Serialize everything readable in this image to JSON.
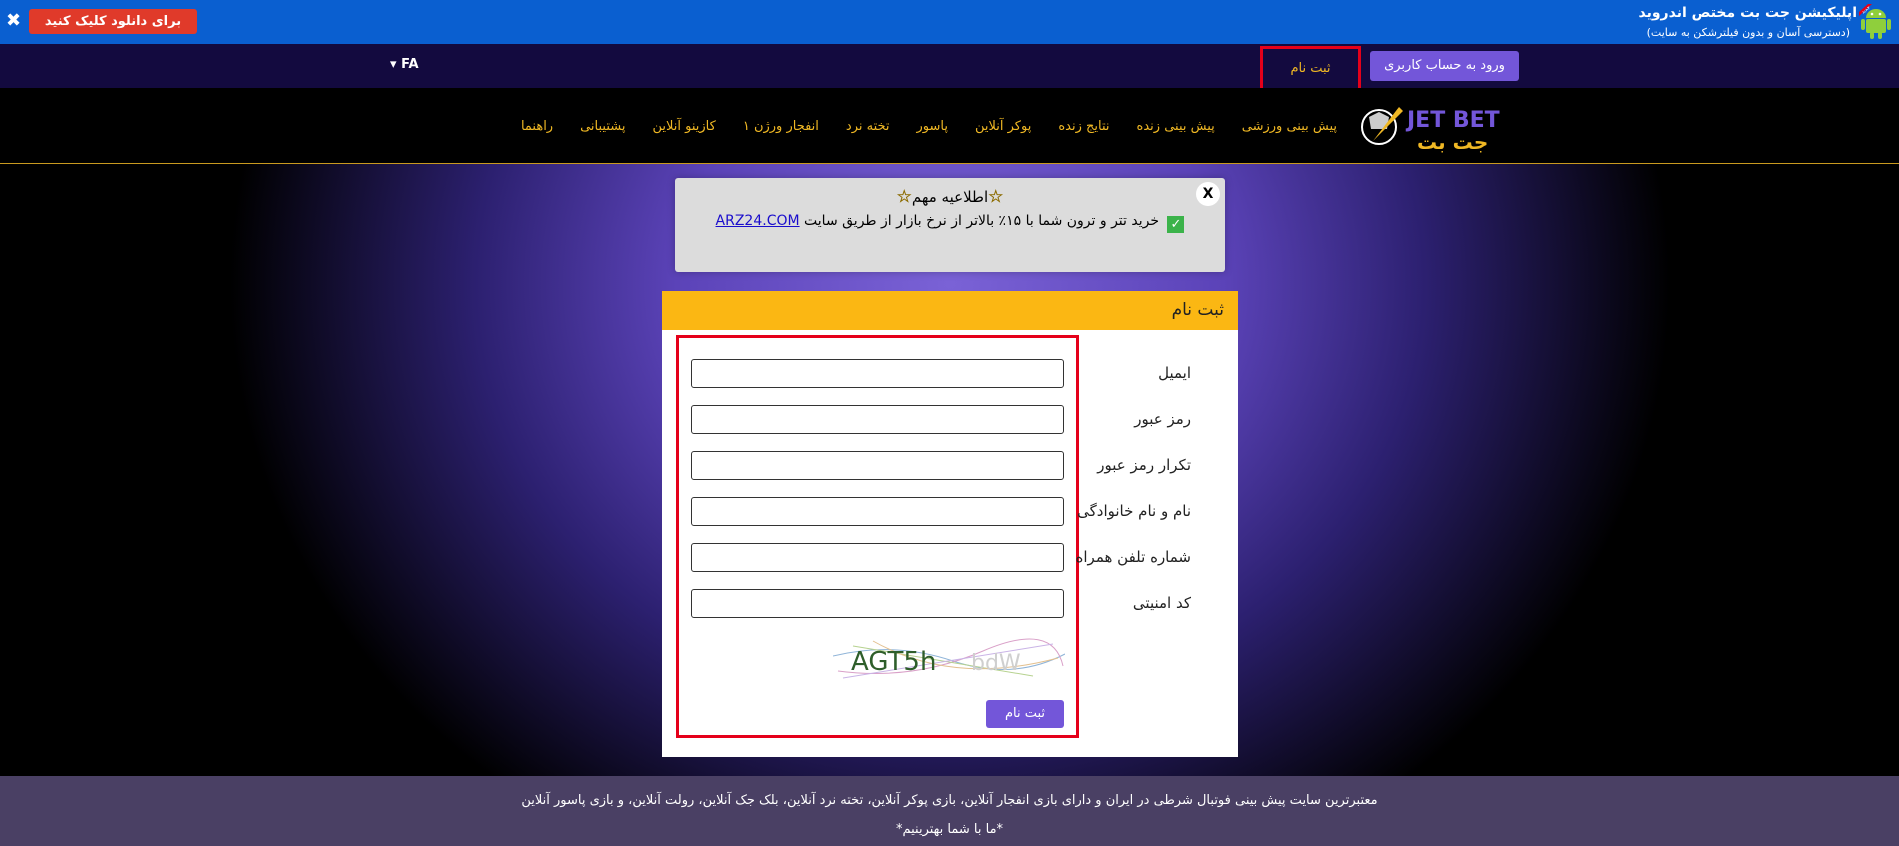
{
  "top_banner": {
    "close_icon": "close-icon",
    "download_button": "برای دانلود کلیک کنید",
    "app_title": "اپلیکیشن جت بت مختص اندروید",
    "app_subtitle": "(دسترسی آسان و بدون فیلترشکن به سایت)",
    "badge": "جدید",
    "icon": "android-icon"
  },
  "user_bar": {
    "login_button": "ورود به حساب کاربری",
    "register_link": "ثبت نام",
    "language": "FA",
    "language_icon": "caret-down-icon"
  },
  "nav": {
    "logo_top": "JET BET",
    "logo_bottom": "جت بت",
    "items": [
      "پیش بینی ورزشی",
      "پیش بینی زنده",
      "نتایج زنده",
      "پوکر آنلاین",
      "پاسور",
      "تخته نرد",
      "انفجار ورژن ۱",
      "کازینو آنلاین",
      "پشتیبانی",
      "راهنما"
    ]
  },
  "notice": {
    "close": "X",
    "title": "اطلاعیه مهم",
    "body": "خرید تتر و ترون شما با ۱۵٪ بالاتر از نرخ بازار از طریق سایت",
    "link": "ARZ24.COM",
    "icons": [
      "star-icon",
      "check-icon"
    ]
  },
  "registration": {
    "title": "ثبت نام",
    "fields": {
      "email": "ایمیل",
      "password": "رمز عبور",
      "password_repeat": "تکرار رمز عبور",
      "full_name": "نام و نام خانوادگی",
      "mobile": "شماره تلفن همراه",
      "security_code": "کد امنیتی"
    },
    "values": {
      "email": "",
      "password": "",
      "password_repeat": "",
      "full_name": "",
      "mobile": "",
      "security_code": ""
    },
    "captcha_text": "AGT5h",
    "submit": "ثبت نام"
  },
  "footer": {
    "line1": "معتبرترین سایت پیش بینی فوتبال شرطی در ایران و دارای بازی انفجار آنلاین، بازی پوکر آنلاین، تخته نرد آنلاین، بلک جک آنلاین، رولت آنلاین، و بازی پاسور آنلاین",
    "line2": "*ما با شما بهترینیم*"
  },
  "colors": {
    "banner": "#0a5fd0",
    "user_bar": "#130a3f",
    "accent_purple": "#7356d9",
    "accent_gold": "#f0b824",
    "card_header": "#fbb713",
    "highlight_red": "#e5001a"
  }
}
